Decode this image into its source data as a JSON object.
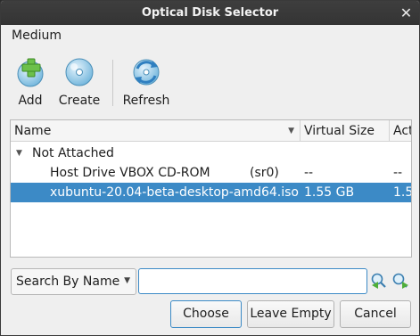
{
  "window": {
    "title": "Optical Disk Selector",
    "close_glyph": "✕"
  },
  "menubar": {
    "items": [
      "Medium"
    ]
  },
  "toolbar": {
    "add_label": "Add",
    "create_label": "Create",
    "refresh_label": "Refresh"
  },
  "tree": {
    "columns": [
      "Name",
      "Virtual Size",
      "Act"
    ],
    "group": {
      "label": "Not Attached",
      "expanded": true
    },
    "rows": [
      {
        "name": "Host Drive VBOX CD-ROM",
        "detail": "(sr0)",
        "virtual_size": "--",
        "actual_size": "--",
        "selected": false
      },
      {
        "name": "xubuntu-20.04-beta-desktop-amd64.iso",
        "detail": "",
        "virtual_size": "1.55 GB",
        "actual_size": "1.5",
        "selected": true
      }
    ]
  },
  "search": {
    "mode_label": "Search By Name",
    "value": "",
    "placeholder": ""
  },
  "buttons": {
    "choose": "Choose",
    "leave_empty": "Leave Empty",
    "cancel": "Cancel"
  },
  "colors": {
    "accent": "#3c8ac6",
    "titlebar": "#383838"
  },
  "icons": [
    "add-disk-icon",
    "create-disk-icon",
    "refresh-icon",
    "search-previous-icon",
    "search-next-icon"
  ]
}
